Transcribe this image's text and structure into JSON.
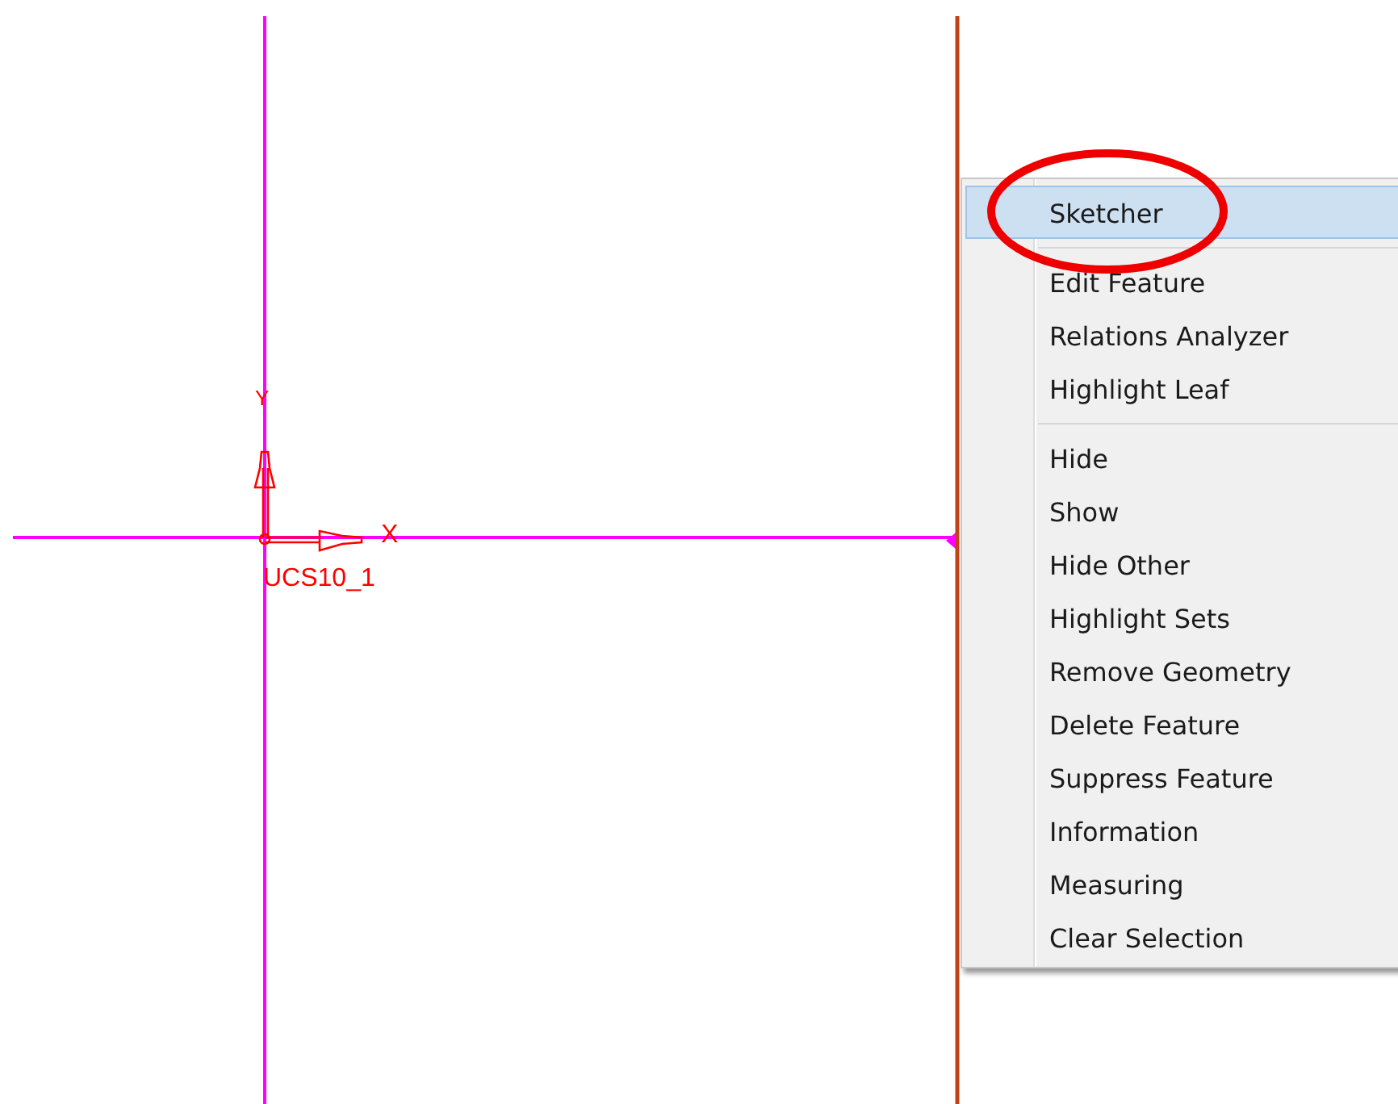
{
  "canvas": {
    "csys_label": "UCS10_1",
    "x_axis_label": "X",
    "y_axis_label": "Y"
  },
  "context_menu": {
    "items": [
      {
        "kind": "item",
        "label": "Sketcher",
        "selected": true
      },
      {
        "kind": "separator"
      },
      {
        "kind": "item",
        "label": "Edit Feature",
        "selected": false
      },
      {
        "kind": "item",
        "label": "Relations Analyzer",
        "selected": false
      },
      {
        "kind": "item",
        "label": "Highlight Leaf",
        "selected": false
      },
      {
        "kind": "separator"
      },
      {
        "kind": "item",
        "label": "Hide",
        "selected": false
      },
      {
        "kind": "item",
        "label": "Show",
        "selected": false
      },
      {
        "kind": "item",
        "label": "Hide Other",
        "selected": false
      },
      {
        "kind": "item",
        "label": "Highlight Sets",
        "selected": false
      },
      {
        "kind": "item",
        "label": "Remove Geometry",
        "selected": false
      },
      {
        "kind": "item",
        "label": "Delete Feature",
        "selected": false
      },
      {
        "kind": "item",
        "label": "Suppress Feature",
        "selected": false
      },
      {
        "kind": "item",
        "label": "Information",
        "selected": false
      },
      {
        "kind": "item",
        "label": "Measuring",
        "selected": false
      },
      {
        "kind": "item",
        "label": "Clear Selection",
        "selected": false
      }
    ]
  }
}
